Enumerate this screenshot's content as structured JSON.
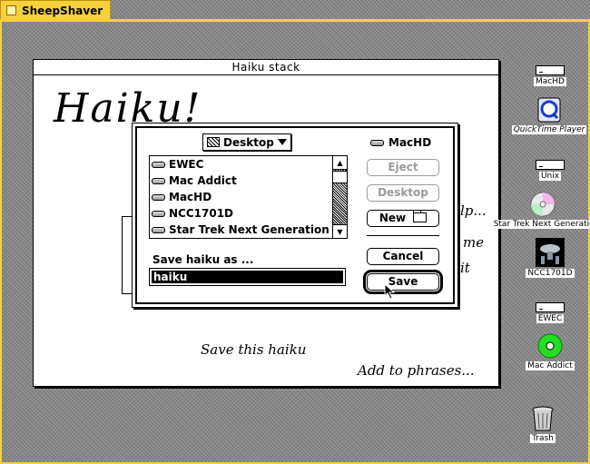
{
  "host": {
    "app_title": "SheepShaver"
  },
  "stack": {
    "window_title": "Haiku stack",
    "logo_text": "Haiku!",
    "right_fragments": [
      "lp...",
      "me",
      "it"
    ],
    "save_link": "Save this haiku",
    "add_link": "Add to phrases..."
  },
  "dialog": {
    "folder_popup": "Desktop",
    "volume_name": "MacHD",
    "files": [
      "EWEC",
      "Mac Addict",
      "MacHD",
      "NCC1701D",
      "Star Trek Next Generation"
    ],
    "buttons": {
      "eject": "Eject",
      "desktop": "Desktop",
      "new": "New",
      "cancel": "Cancel",
      "save": "Save"
    },
    "prompt": "Save haiku as ...",
    "filename_value": "haiku"
  },
  "desktop_icons": [
    {
      "label": "MacHD",
      "icon": "hard-drive-icon"
    },
    {
      "label": "QuickTime Player",
      "icon": "quicktime-icon"
    },
    {
      "label": "Unix",
      "icon": "unix-volume-icon"
    },
    {
      "label": "Star Trek Next Generation",
      "icon": "cd-icon"
    },
    {
      "label": "NCC1701D",
      "icon": "starship-icon"
    },
    {
      "label": "EWEC",
      "icon": "drive-icon"
    },
    {
      "label": "Mac Addict",
      "icon": "green-cd-icon"
    },
    {
      "label": "Trash",
      "icon": "trash-icon"
    }
  ],
  "colors": {
    "host_accent": "#f7d13c",
    "desktop_gray": "#8c8c8c",
    "addict_green": "#22dd22"
  }
}
